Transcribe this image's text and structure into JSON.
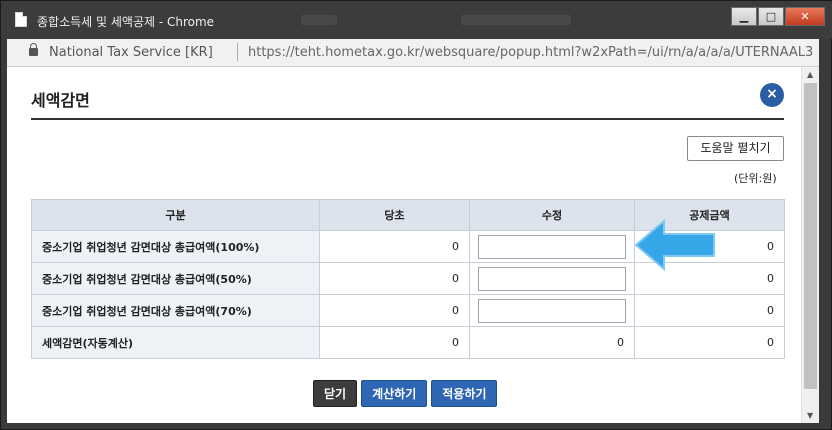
{
  "window": {
    "title": "종합소득세 및 세액공제 - Chrome",
    "minimize_label": "▁",
    "maximize_label": "□",
    "close_label": "✕"
  },
  "address": {
    "site": "National Tax Service [KR]",
    "url": "https://teht.hometax.go.kr/websquare/popup.html?w2xPath=/ui/rn/a/a/a/a/UTERNAAL3..."
  },
  "panel": {
    "title": "세액감면",
    "close_label": "×",
    "help_button": "도움말 펼치기",
    "unit": "(단위:원)"
  },
  "table": {
    "headers": [
      "구분",
      "당초",
      "수정",
      "공제금액"
    ],
    "rows": [
      {
        "label": "중소기업 취업청년 감면대상 총급여액(100%)",
        "original": "0",
        "modified": "",
        "deduction": "0"
      },
      {
        "label": "중소기업 취업청년 감면대상 총급여액(50%)",
        "original": "0",
        "modified": "",
        "deduction": "0"
      },
      {
        "label": "중소기업 취업청년 감면대상 총급여액(70%)",
        "original": "0",
        "modified": "",
        "deduction": "0"
      },
      {
        "label": "세액감면(자동계산)",
        "original": "0",
        "modified": "0",
        "deduction": "0"
      }
    ]
  },
  "buttons": {
    "close": "닫기",
    "calculate": "계산하기",
    "apply": "적용하기"
  },
  "colors": {
    "accent_blue": "#2e66b3",
    "arrow_blue": "#35a6e8",
    "header_bg": "#dde3ec"
  },
  "icons": {
    "page": "document-icon",
    "lock": "lock-icon",
    "arrow": "arrow-left-icon"
  }
}
